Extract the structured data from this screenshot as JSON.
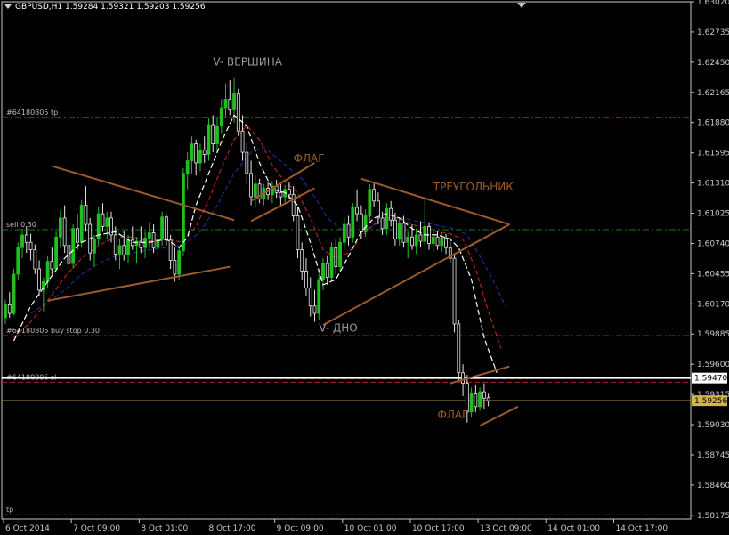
{
  "header": {
    "symbol": "GBPUSD,H1",
    "open": "1.59284",
    "high": "1.59321",
    "low": "1.59203",
    "close": "1.59256"
  },
  "colors": {
    "background": "#000000",
    "bull": "#1fbf1f",
    "bear": "#e8e8e8",
    "axis": "#c8c8c8",
    "level_red": "#b02020",
    "level_green": "#1a7a1a",
    "pattern": "#9a5a2a",
    "ma_fast": "#ffffff",
    "ma_mid": "#b22222",
    "ma_slow": "#1c2e8c",
    "price_label_bg": "#ffffff",
    "close_label_bg": "#d4b44a"
  },
  "chart_data": {
    "type": "candlestick",
    "ylim": [
      1.5814,
      1.6302
    ],
    "y_ticks": [
      "1.63020",
      "1.62735",
      "1.62450",
      "1.62165",
      "1.61880",
      "1.61595",
      "1.61310",
      "1.61025",
      "1.60740",
      "1.60455",
      "1.60170",
      "1.59885",
      "1.59600",
      "1.59315",
      "1.59030",
      "1.58745",
      "1.58460",
      "1.58175"
    ],
    "x_ticks": [
      "6 Oct 2014",
      "7 Oct 09:00",
      "8 Oct 01:00",
      "8 Oct 17:00",
      "9 Oct 09:00",
      "10 Oct 01:00",
      "10 Oct 17:00",
      "13 Oct 09:00",
      "14 Oct 01:00",
      "14 Oct 17:00"
    ],
    "levels": [
      {
        "label": "#64180805 tp",
        "price": 1.6193,
        "color": "#b02020",
        "style": "dashdot"
      },
      {
        "label": "sell 0.30",
        "price": 1.6087,
        "color": "#1a7a1a",
        "style": "dashdot"
      },
      {
        "label": "#64180805 buy stop 0.30",
        "price": 1.5987,
        "color": "#b02020",
        "style": "dashdot"
      },
      {
        "label": "#64180805 sl",
        "price": 1.5943,
        "color": "#b02020",
        "style": "dashed"
      },
      {
        "label": "tp",
        "price": 1.5818,
        "color": "#b02020",
        "style": "dashdot"
      }
    ],
    "bid_line": {
      "price": 1.5947,
      "label": "1.59470"
    },
    "close_line": {
      "price": 1.59256,
      "label": "1.59256"
    },
    "annotations": [
      {
        "text": "V- ВЕРШИНА",
        "at": [
          49,
          1.6242
        ],
        "color": "#9a9a9a"
      },
      {
        "text": "ФЛАГ",
        "at": [
          68,
          1.6151
        ],
        "color": "#9a5a2a"
      },
      {
        "text": "ТРЕУГОЛЬНИК",
        "at": [
          101,
          1.6124
        ],
        "color": "#9a5a2a"
      },
      {
        "text": "V- ДНО",
        "at": [
          74,
          1.5991
        ],
        "color": "#9a9a9a"
      },
      {
        "text": "ФЛАГ",
        "at": [
          102,
          1.5909
        ],
        "color": "#9a5a2a"
      }
    ],
    "pattern_lines": [
      {
        "from": [
          11,
          1.6147
        ],
        "to": [
          54,
          1.6096
        ]
      },
      {
        "from": [
          10,
          1.602
        ],
        "to": [
          53,
          1.6052
        ]
      },
      {
        "from": [
          58,
          1.6114
        ],
        "to": [
          73,
          1.615
        ]
      },
      {
        "from": [
          58,
          1.6095
        ],
        "to": [
          73,
          1.6126
        ]
      },
      {
        "from": [
          75,
          1.5997
        ],
        "to": [
          119,
          1.6092
        ]
      },
      {
        "from": [
          84,
          1.6135
        ],
        "to": [
          119,
          1.6092
        ]
      },
      {
        "from": [
          105,
          1.5942
        ],
        "to": [
          119,
          1.5958
        ]
      },
      {
        "from": [
          112,
          1.5902
        ],
        "to": [
          121,
          1.592
        ]
      }
    ],
    "candles": [
      {
        "o": 1.6004,
        "h": 1.6021,
        "l": 1.5998,
        "c": 1.6016
      },
      {
        "o": 1.6016,
        "h": 1.6028,
        "l": 1.6004,
        "c": 1.6008
      },
      {
        "o": 1.6008,
        "h": 1.605,
        "l": 1.6006,
        "c": 1.6045
      },
      {
        "o": 1.6045,
        "h": 1.6075,
        "l": 1.604,
        "c": 1.607
      },
      {
        "o": 1.607,
        "h": 1.6088,
        "l": 1.606,
        "c": 1.6082
      },
      {
        "o": 1.6082,
        "h": 1.609,
        "l": 1.6065,
        "c": 1.6075
      },
      {
        "o": 1.6075,
        "h": 1.6083,
        "l": 1.6058,
        "c": 1.6068
      },
      {
        "o": 1.6068,
        "h": 1.6073,
        "l": 1.6045,
        "c": 1.605
      },
      {
        "o": 1.605,
        "h": 1.6058,
        "l": 1.6025,
        "c": 1.603
      },
      {
        "o": 1.603,
        "h": 1.6042,
        "l": 1.601,
        "c": 1.6038
      },
      {
        "o": 1.6038,
        "h": 1.6062,
        "l": 1.6032,
        "c": 1.6057
      },
      {
        "o": 1.6057,
        "h": 1.607,
        "l": 1.6045,
        "c": 1.605
      },
      {
        "o": 1.605,
        "h": 1.6085,
        "l": 1.6048,
        "c": 1.608
      },
      {
        "o": 1.608,
        "h": 1.6105,
        "l": 1.607,
        "c": 1.6098
      },
      {
        "o": 1.6098,
        "h": 1.611,
        "l": 1.6065,
        "c": 1.6072
      },
      {
        "o": 1.6072,
        "h": 1.608,
        "l": 1.6045,
        "c": 1.6055
      },
      {
        "o": 1.6055,
        "h": 1.6092,
        "l": 1.605,
        "c": 1.6088
      },
      {
        "o": 1.6088,
        "h": 1.6102,
        "l": 1.6068,
        "c": 1.6075
      },
      {
        "o": 1.6075,
        "h": 1.6115,
        "l": 1.607,
        "c": 1.611
      },
      {
        "o": 1.611,
        "h": 1.6128,
        "l": 1.6085,
        "c": 1.6092
      },
      {
        "o": 1.6092,
        "h": 1.6098,
        "l": 1.6058,
        "c": 1.6065
      },
      {
        "o": 1.6065,
        "h": 1.6082,
        "l": 1.6052,
        "c": 1.6078
      },
      {
        "o": 1.6078,
        "h": 1.6108,
        "l": 1.6072,
        "c": 1.6102
      },
      {
        "o": 1.6102,
        "h": 1.6112,
        "l": 1.6085,
        "c": 1.609
      },
      {
        "o": 1.609,
        "h": 1.6104,
        "l": 1.6078,
        "c": 1.6098
      },
      {
        "o": 1.6098,
        "h": 1.6104,
        "l": 1.6075,
        "c": 1.6082
      },
      {
        "o": 1.6082,
        "h": 1.609,
        "l": 1.6058,
        "c": 1.6064
      },
      {
        "o": 1.6064,
        "h": 1.6078,
        "l": 1.605,
        "c": 1.6072
      },
      {
        "o": 1.6072,
        "h": 1.6086,
        "l": 1.6058,
        "c": 1.6063
      },
      {
        "o": 1.6063,
        "h": 1.6082,
        "l": 1.6055,
        "c": 1.6077
      },
      {
        "o": 1.6077,
        "h": 1.609,
        "l": 1.6068,
        "c": 1.6072
      },
      {
        "o": 1.6072,
        "h": 1.608,
        "l": 1.6055,
        "c": 1.6076
      },
      {
        "o": 1.6076,
        "h": 1.609,
        "l": 1.6065,
        "c": 1.607
      },
      {
        "o": 1.607,
        "h": 1.6085,
        "l": 1.606,
        "c": 1.6079
      },
      {
        "o": 1.6079,
        "h": 1.6094,
        "l": 1.607,
        "c": 1.6084
      },
      {
        "o": 1.6084,
        "h": 1.6092,
        "l": 1.6065,
        "c": 1.607
      },
      {
        "o": 1.607,
        "h": 1.6083,
        "l": 1.6062,
        "c": 1.6078
      },
      {
        "o": 1.6078,
        "h": 1.6104,
        "l": 1.6072,
        "c": 1.6099
      },
      {
        "o": 1.6099,
        "h": 1.6102,
        "l": 1.6072,
        "c": 1.6077
      },
      {
        "o": 1.6077,
        "h": 1.6082,
        "l": 1.605,
        "c": 1.6058
      },
      {
        "o": 1.6058,
        "h": 1.607,
        "l": 1.6038,
        "c": 1.6045
      },
      {
        "o": 1.6045,
        "h": 1.607,
        "l": 1.604,
        "c": 1.6067
      },
      {
        "o": 1.6067,
        "h": 1.6145,
        "l": 1.6062,
        "c": 1.614
      },
      {
        "o": 1.614,
        "h": 1.616,
        "l": 1.6125,
        "c": 1.6152
      },
      {
        "o": 1.6152,
        "h": 1.6175,
        "l": 1.614,
        "c": 1.6168
      },
      {
        "o": 1.6168,
        "h": 1.6172,
        "l": 1.6138,
        "c": 1.615
      },
      {
        "o": 1.615,
        "h": 1.6168,
        "l": 1.6142,
        "c": 1.6162
      },
      {
        "o": 1.6162,
        "h": 1.6175,
        "l": 1.615,
        "c": 1.6158
      },
      {
        "o": 1.6158,
        "h": 1.6192,
        "l": 1.6152,
        "c": 1.6186
      },
      {
        "o": 1.6186,
        "h": 1.6195,
        "l": 1.616,
        "c": 1.6168
      },
      {
        "o": 1.6168,
        "h": 1.6192,
        "l": 1.616,
        "c": 1.6185
      },
      {
        "o": 1.6185,
        "h": 1.621,
        "l": 1.6178,
        "c": 1.6202
      },
      {
        "o": 1.6202,
        "h": 1.6225,
        "l": 1.6192,
        "c": 1.621
      },
      {
        "o": 1.621,
        "h": 1.6228,
        "l": 1.6195,
        "c": 1.62
      },
      {
        "o": 1.62,
        "h": 1.623,
        "l": 1.6188,
        "c": 1.6215
      },
      {
        "o": 1.6215,
        "h": 1.622,
        "l": 1.6175,
        "c": 1.618
      },
      {
        "o": 1.618,
        "h": 1.6195,
        "l": 1.6152,
        "c": 1.616
      },
      {
        "o": 1.616,
        "h": 1.617,
        "l": 1.613,
        "c": 1.614
      },
      {
        "o": 1.614,
        "h": 1.6152,
        "l": 1.611,
        "c": 1.6118
      },
      {
        "o": 1.6118,
        "h": 1.6138,
        "l": 1.6108,
        "c": 1.613
      },
      {
        "o": 1.613,
        "h": 1.6135,
        "l": 1.6112,
        "c": 1.6116
      },
      {
        "o": 1.6116,
        "h": 1.613,
        "l": 1.611,
        "c": 1.6126
      },
      {
        "o": 1.6126,
        "h": 1.6132,
        "l": 1.6115,
        "c": 1.612
      },
      {
        "o": 1.612,
        "h": 1.6133,
        "l": 1.6112,
        "c": 1.6128
      },
      {
        "o": 1.6128,
        "h": 1.6134,
        "l": 1.6117,
        "c": 1.6122
      },
      {
        "o": 1.6122,
        "h": 1.613,
        "l": 1.611,
        "c": 1.6118
      },
      {
        "o": 1.6118,
        "h": 1.6129,
        "l": 1.6112,
        "c": 1.6125
      },
      {
        "o": 1.6125,
        "h": 1.6132,
        "l": 1.6116,
        "c": 1.612
      },
      {
        "o": 1.612,
        "h": 1.6128,
        "l": 1.6095,
        "c": 1.61
      },
      {
        "o": 1.61,
        "h": 1.6108,
        "l": 1.606,
        "c": 1.6068
      },
      {
        "o": 1.6068,
        "h": 1.6075,
        "l": 1.604,
        "c": 1.6048
      },
      {
        "o": 1.6048,
        "h": 1.606,
        "l": 1.6025,
        "c": 1.6032
      },
      {
        "o": 1.6032,
        "h": 1.6042,
        "l": 1.6005,
        "c": 1.6015
      },
      {
        "o": 1.6015,
        "h": 1.603,
        "l": 1.6,
        "c": 1.6008
      },
      {
        "o": 1.6008,
        "h": 1.6045,
        "l": 1.6002,
        "c": 1.604
      },
      {
        "o": 1.604,
        "h": 1.606,
        "l": 1.603,
        "c": 1.6055
      },
      {
        "o": 1.6055,
        "h": 1.6062,
        "l": 1.6035,
        "c": 1.6042
      },
      {
        "o": 1.6042,
        "h": 1.6075,
        "l": 1.6038,
        "c": 1.607
      },
      {
        "o": 1.607,
        "h": 1.6078,
        "l": 1.6045,
        "c": 1.6052
      },
      {
        "o": 1.6052,
        "h": 1.608,
        "l": 1.6048,
        "c": 1.6075
      },
      {
        "o": 1.6075,
        "h": 1.6098,
        "l": 1.6068,
        "c": 1.6092
      },
      {
        "o": 1.6092,
        "h": 1.61,
        "l": 1.6072,
        "c": 1.608
      },
      {
        "o": 1.608,
        "h": 1.6112,
        "l": 1.6075,
        "c": 1.6108
      },
      {
        "o": 1.6108,
        "h": 1.6125,
        "l": 1.6095,
        "c": 1.6102
      },
      {
        "o": 1.6102,
        "h": 1.611,
        "l": 1.6078,
        "c": 1.6085
      },
      {
        "o": 1.6085,
        "h": 1.6106,
        "l": 1.608,
        "c": 1.61
      },
      {
        "o": 1.61,
        "h": 1.613,
        "l": 1.6095,
        "c": 1.6125
      },
      {
        "o": 1.6125,
        "h": 1.6132,
        "l": 1.6108,
        "c": 1.6114
      },
      {
        "o": 1.6114,
        "h": 1.6122,
        "l": 1.6092,
        "c": 1.6098
      },
      {
        "o": 1.6098,
        "h": 1.6104,
        "l": 1.6082,
        "c": 1.6088
      },
      {
        "o": 1.6088,
        "h": 1.6112,
        "l": 1.6082,
        "c": 1.6107
      },
      {
        "o": 1.6107,
        "h": 1.6114,
        "l": 1.609,
        "c": 1.6096
      },
      {
        "o": 1.6096,
        "h": 1.6103,
        "l": 1.6072,
        "c": 1.6078
      },
      {
        "o": 1.6078,
        "h": 1.6098,
        "l": 1.6072,
        "c": 1.6093
      },
      {
        "o": 1.6093,
        "h": 1.61,
        "l": 1.607,
        "c": 1.6075
      },
      {
        "o": 1.6075,
        "h": 1.6085,
        "l": 1.606,
        "c": 1.608
      },
      {
        "o": 1.608,
        "h": 1.6092,
        "l": 1.6068,
        "c": 1.6072
      },
      {
        "o": 1.6072,
        "h": 1.6088,
        "l": 1.6064,
        "c": 1.6082
      },
      {
        "o": 1.6082,
        "h": 1.6095,
        "l": 1.607,
        "c": 1.6076
      },
      {
        "o": 1.6076,
        "h": 1.6118,
        "l": 1.6072,
        "c": 1.609
      },
      {
        "o": 1.609,
        "h": 1.6094,
        "l": 1.6068,
        "c": 1.6074
      },
      {
        "o": 1.6074,
        "h": 1.6086,
        "l": 1.6066,
        "c": 1.608
      },
      {
        "o": 1.608,
        "h": 1.6086,
        "l": 1.6068,
        "c": 1.6072
      },
      {
        "o": 1.6072,
        "h": 1.6084,
        "l": 1.6066,
        "c": 1.6079
      },
      {
        "o": 1.6079,
        "h": 1.6083,
        "l": 1.6064,
        "c": 1.607
      },
      {
        "o": 1.607,
        "h": 1.6078,
        "l": 1.6055,
        "c": 1.606
      },
      {
        "o": 1.606,
        "h": 1.6064,
        "l": 1.599,
        "c": 1.5998
      },
      {
        "o": 1.5998,
        "h": 1.6002,
        "l": 1.5945,
        "c": 1.5952
      },
      {
        "o": 1.5952,
        "h": 1.596,
        "l": 1.593,
        "c": 1.5942
      },
      {
        "o": 1.5942,
        "h": 1.595,
        "l": 1.5905,
        "c": 1.5915
      },
      {
        "o": 1.5915,
        "h": 1.5938,
        "l": 1.591,
        "c": 1.5932
      },
      {
        "o": 1.5932,
        "h": 1.594,
        "l": 1.5915,
        "c": 1.592
      },
      {
        "o": 1.592,
        "h": 1.5938,
        "l": 1.5916,
        "c": 1.5934
      },
      {
        "o": 1.5934,
        "h": 1.5942,
        "l": 1.5918,
        "c": 1.5928
      },
      {
        "o": 1.59284,
        "h": 1.59321,
        "l": 1.59203,
        "c": 1.59256
      }
    ],
    "ma_fast": [
      [
        2,
        1.5982
      ],
      [
        6,
        1.6015
      ],
      [
        10,
        1.6038
      ],
      [
        14,
        1.606
      ],
      [
        18,
        1.6075
      ],
      [
        22,
        1.6082
      ],
      [
        26,
        1.6085
      ],
      [
        30,
        1.6075
      ],
      [
        34,
        1.6075
      ],
      [
        38,
        1.6078
      ],
      [
        41,
        1.607
      ],
      [
        43,
        1.608
      ],
      [
        45,
        1.611
      ],
      [
        48,
        1.614
      ],
      [
        51,
        1.617
      ],
      [
        54,
        1.6195
      ],
      [
        57,
        1.6185
      ],
      [
        60,
        1.615
      ],
      [
        63,
        1.6125
      ],
      [
        66,
        1.6122
      ],
      [
        69,
        1.611
      ],
      [
        72,
        1.6075
      ],
      [
        75,
        1.6035
      ],
      [
        78,
        1.604
      ],
      [
        81,
        1.6062
      ],
      [
        84,
        1.6085
      ],
      [
        87,
        1.6098
      ],
      [
        90,
        1.6102
      ],
      [
        93,
        1.6098
      ],
      [
        96,
        1.6088
      ],
      [
        99,
        1.6082
      ],
      [
        102,
        1.6082
      ],
      [
        105,
        1.6078
      ],
      [
        107,
        1.607
      ],
      [
        110,
        1.604
      ],
      [
        113,
        1.5985
      ],
      [
        116,
        1.5952
      ]
    ],
    "ma_mid": [
      [
        2,
        1.5985
      ],
      [
        6,
        1.6
      ],
      [
        10,
        1.602
      ],
      [
        14,
        1.6042
      ],
      [
        18,
        1.606
      ],
      [
        22,
        1.6072
      ],
      [
        26,
        1.608
      ],
      [
        30,
        1.608
      ],
      [
        34,
        1.6076
      ],
      [
        38,
        1.6078
      ],
      [
        42,
        1.6075
      ],
      [
        45,
        1.609
      ],
      [
        48,
        1.6115
      ],
      [
        51,
        1.6145
      ],
      [
        54,
        1.6172
      ],
      [
        57,
        1.6185
      ],
      [
        60,
        1.6172
      ],
      [
        63,
        1.6148
      ],
      [
        66,
        1.6132
      ],
      [
        69,
        1.6122
      ],
      [
        72,
        1.6098
      ],
      [
        75,
        1.6068
      ],
      [
        78,
        1.606
      ],
      [
        81,
        1.6065
      ],
      [
        84,
        1.608
      ],
      [
        87,
        1.6092
      ],
      [
        90,
        1.6098
      ],
      [
        93,
        1.6098
      ],
      [
        96,
        1.6092
      ],
      [
        99,
        1.6088
      ],
      [
        102,
        1.6085
      ],
      [
        105,
        1.6083
      ],
      [
        108,
        1.6078
      ],
      [
        111,
        1.605
      ],
      [
        114,
        1.601
      ],
      [
        117,
        1.5975
      ]
    ],
    "ma_slow": [
      [
        6,
        1.6008
      ],
      [
        10,
        1.6018
      ],
      [
        14,
        1.603
      ],
      [
        18,
        1.6045
      ],
      [
        22,
        1.6055
      ],
      [
        26,
        1.6062
      ],
      [
        30,
        1.6065
      ],
      [
        34,
        1.6068
      ],
      [
        38,
        1.607
      ],
      [
        42,
        1.6072
      ],
      [
        46,
        1.6085
      ],
      [
        50,
        1.611
      ],
      [
        54,
        1.614
      ],
      [
        58,
        1.616
      ],
      [
        61,
        1.6165
      ],
      [
        64,
        1.6155
      ],
      [
        67,
        1.6145
      ],
      [
        70,
        1.6135
      ],
      [
        73,
        1.6118
      ],
      [
        76,
        1.6098
      ],
      [
        79,
        1.6088
      ],
      [
        82,
        1.6085
      ],
      [
        85,
        1.6088
      ],
      [
        88,
        1.6093
      ],
      [
        91,
        1.6097
      ],
      [
        94,
        1.6098
      ],
      [
        97,
        1.6095
      ],
      [
        100,
        1.6093
      ],
      [
        103,
        1.609
      ],
      [
        106,
        1.6088
      ],
      [
        109,
        1.6082
      ],
      [
        112,
        1.6062
      ],
      [
        115,
        1.604
      ],
      [
        118,
        1.6015
      ]
    ]
  }
}
